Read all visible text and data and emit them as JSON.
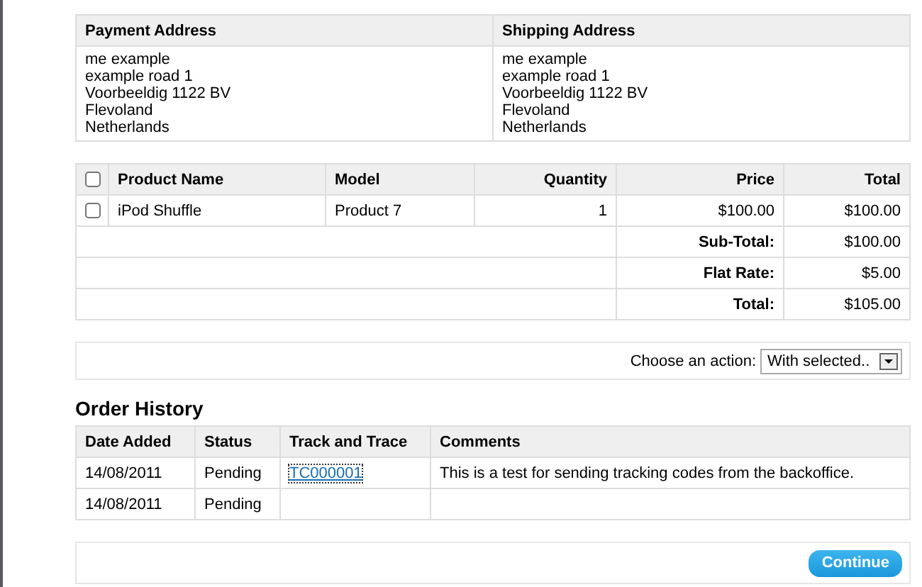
{
  "addresses": {
    "columns": [
      "Payment Address",
      "Shipping Address"
    ],
    "blocks": [
      [
        "me example",
        "example road 1",
        "Voorbeeldig 1122 BV",
        "Flevoland",
        "Netherlands"
      ],
      [
        "me example",
        "example road 1",
        "Voorbeeldig 1122 BV",
        "Flevoland",
        "Netherlands"
      ]
    ]
  },
  "products": {
    "header_checked": false,
    "columns": [
      "Product Name",
      "Model",
      "Quantity",
      "Price",
      "Total"
    ],
    "rows": [
      {
        "checked": false,
        "name": "iPod Shuffle",
        "model": "Product 7",
        "quantity": "1",
        "price": "$100.00",
        "total": "$100.00"
      }
    ],
    "totals": [
      {
        "label": "Sub-Total:",
        "value": "$100.00"
      },
      {
        "label": "Flat Rate:",
        "value": "$5.00"
      },
      {
        "label": "Total:",
        "value": "$105.00"
      }
    ]
  },
  "action": {
    "label": "Choose an action:",
    "value": "With selected.."
  },
  "history": {
    "title": "Order History",
    "columns": [
      "Date Added",
      "Status",
      "Track and Trace",
      "Comments"
    ],
    "rows": [
      {
        "date": "14/08/2011",
        "status": "Pending",
        "track": "TC000001",
        "comment": "This is a test for sending tracking codes from the backoffice."
      },
      {
        "date": "14/08/2011",
        "status": "Pending"
      }
    ]
  },
  "continue_button": "Continue"
}
